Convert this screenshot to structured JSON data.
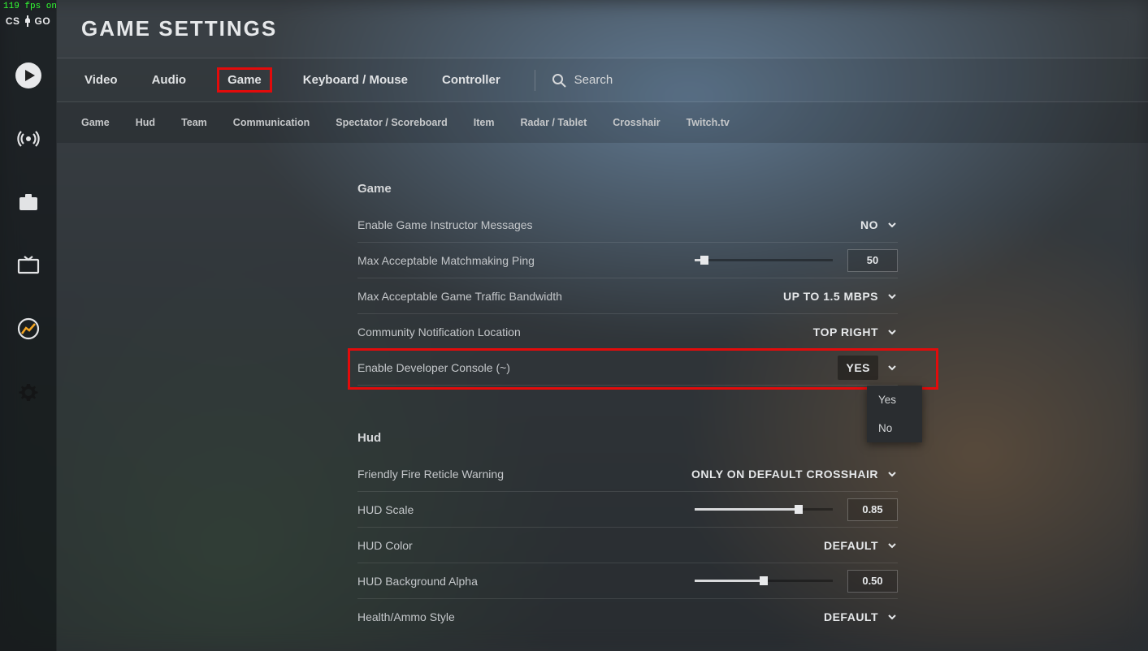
{
  "fps_overlay": "119 fps on",
  "logo_text": {
    "left": "CS",
    "right": "GO"
  },
  "page_title": "GAME SETTINGS",
  "primary_tabs": {
    "video": "Video",
    "audio": "Audio",
    "game": "Game",
    "keyboard_mouse": "Keyboard / Mouse",
    "controller": "Controller"
  },
  "search_label": "Search",
  "secondary_tabs": {
    "game": "Game",
    "hud": "Hud",
    "team": "Team",
    "communication": "Communication",
    "spectator": "Spectator / Scoreboard",
    "item": "Item",
    "radar": "Radar / Tablet",
    "crosshair": "Crosshair",
    "twitch": "Twitch.tv"
  },
  "sections": {
    "game": {
      "header": "Game",
      "rows": {
        "instructor": {
          "label": "Enable Game Instructor Messages",
          "value": "NO"
        },
        "ping": {
          "label": "Max Acceptable Matchmaking Ping",
          "value": "50",
          "slider_pct": 7
        },
        "bandwidth": {
          "label": "Max Acceptable Game Traffic Bandwidth",
          "value": "UP TO 1.5 MBPS"
        },
        "notif_loc": {
          "label": "Community Notification Location",
          "value": "TOP RIGHT"
        },
        "dev_console": {
          "label": "Enable Developer Console (~)",
          "value": "YES",
          "options": {
            "yes": "Yes",
            "no": "No"
          }
        }
      }
    },
    "hud": {
      "header": "Hud",
      "rows": {
        "ff_reticle": {
          "label": "Friendly Fire Reticle Warning",
          "value": "ONLY ON DEFAULT CROSSHAIR"
        },
        "hud_scale": {
          "label": "HUD Scale",
          "value": "0.85",
          "slider_pct": 75
        },
        "hud_color": {
          "label": "HUD Color",
          "value": "DEFAULT"
        },
        "hud_alpha": {
          "label": "HUD Background Alpha",
          "value": "0.50",
          "slider_pct": 50
        },
        "health_style": {
          "label": "Health/Ammo Style",
          "value": "DEFAULT"
        }
      }
    }
  }
}
